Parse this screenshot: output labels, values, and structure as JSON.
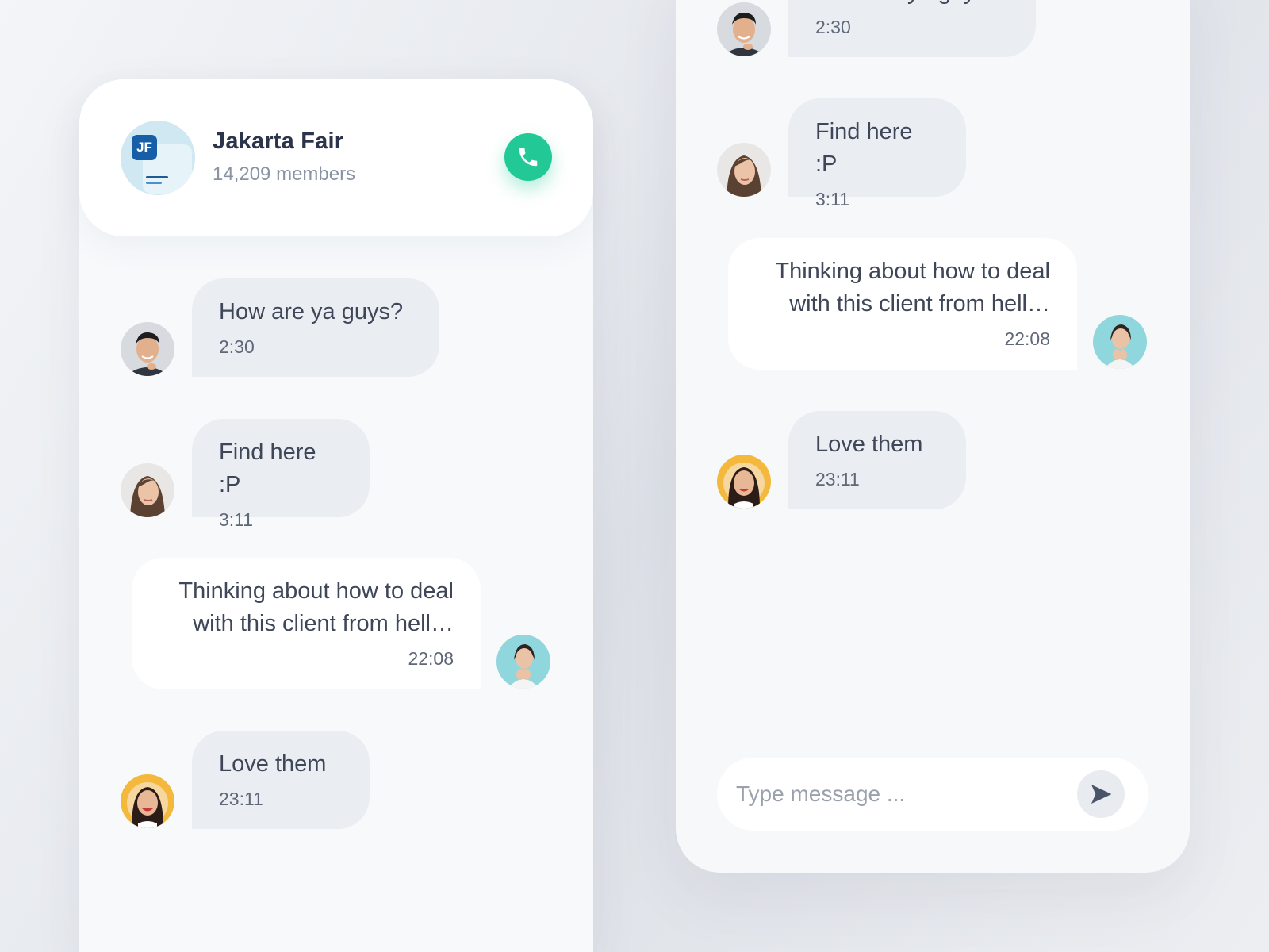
{
  "group": {
    "initials": "JF",
    "name": "Jakarta Fair",
    "members": "14,209 members"
  },
  "icons": {
    "call": "phone-icon",
    "send": "send-arrow-icon"
  },
  "colors": {
    "call_button": "#22c996",
    "incoming_bubble": "#eaedf1",
    "outgoing_bubble": "#ffffff",
    "badge": "#165ea8"
  },
  "left_chat": {
    "messages": [
      {
        "sender": "man",
        "direction": "incoming",
        "text": "How are ya guys?",
        "time": "2:30"
      },
      {
        "sender": "woman-brunette",
        "direction": "incoming",
        "text": "Find here :P",
        "time": "3:11"
      },
      {
        "sender": "me",
        "direction": "outgoing",
        "text": "Thinking about how to deal\nwith this client from hell…",
        "time": "22:08"
      },
      {
        "sender": "woman-smiling",
        "direction": "incoming",
        "text": "Love them",
        "time": "23:11"
      }
    ]
  },
  "right_chat": {
    "messages": [
      {
        "sender": "man",
        "direction": "incoming",
        "text": "How are ya guys?",
        "time": "2:30"
      },
      {
        "sender": "woman-brunette",
        "direction": "incoming",
        "text": "Find here :P",
        "time": "3:11"
      },
      {
        "sender": "me",
        "direction": "outgoing",
        "text": "Thinking about how to deal\nwith this client from hell…",
        "time": "22:08"
      },
      {
        "sender": "woman-smiling",
        "direction": "incoming",
        "text": "Love them",
        "time": "23:11"
      }
    ],
    "composer": {
      "placeholder": "Type message ..."
    }
  }
}
